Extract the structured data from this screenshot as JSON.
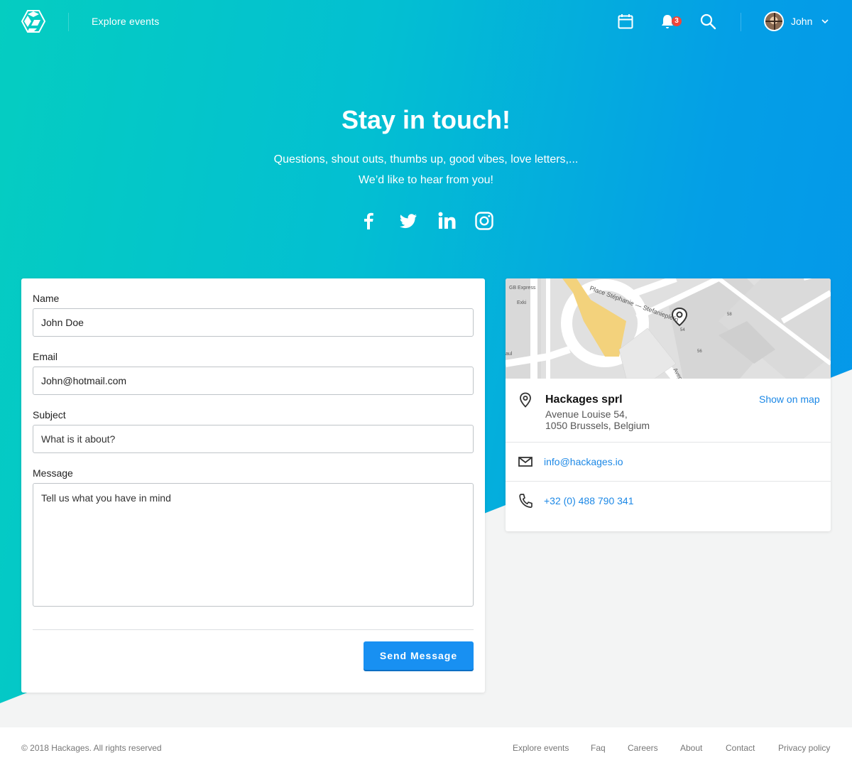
{
  "header": {
    "nav_link": "Explore events",
    "notification_count": "3",
    "user_name": "John"
  },
  "hero": {
    "title": "Stay in touch!",
    "subtitle_line1": "Questions, shout outs, thumbs up, good vibes, love letters,...",
    "subtitle_line2": "We’d like to hear from you!",
    "social": [
      "facebook-icon",
      "twitter-icon",
      "linkedin-icon",
      "instagram-icon"
    ]
  },
  "form": {
    "name_label": "Name",
    "name_value": "John Doe",
    "email_label": "Email",
    "email_value": "John@hotmail.com",
    "subject_label": "Subject",
    "subject_placeholder": "What is it about?",
    "message_label": "Message",
    "message_placeholder": "Tell us what you have in mind",
    "send_label": "Send Message"
  },
  "info": {
    "map_labels": {
      "shop1": "GB Express",
      "shop2": "Exki",
      "shop3": "aul",
      "street1": "Place Stéphanie — Stefaniepleín",
      "street2": "Aven",
      "num1": "54",
      "num2": "58",
      "num3": "56"
    },
    "company": "Hackages sprl",
    "show_on_map": "Show on map",
    "address_line1": "Avenue Louise 54,",
    "address_line2": "1050 Brussels, Belgium",
    "email": "info@hackages.io",
    "phone": "+32 (0) 488 790 341"
  },
  "footer": {
    "copyright": "© 2018 Hackages. All rights reserved",
    "links": [
      "Explore events",
      "Faq",
      "Careers",
      "About",
      "Contact",
      "Privacy policy"
    ]
  },
  "colors": {
    "gradient_start": "#05cdc1",
    "gradient_end": "#0596ea",
    "primary_button": "#1890f2",
    "link": "#1c88e6",
    "badge": "#f0463a"
  }
}
